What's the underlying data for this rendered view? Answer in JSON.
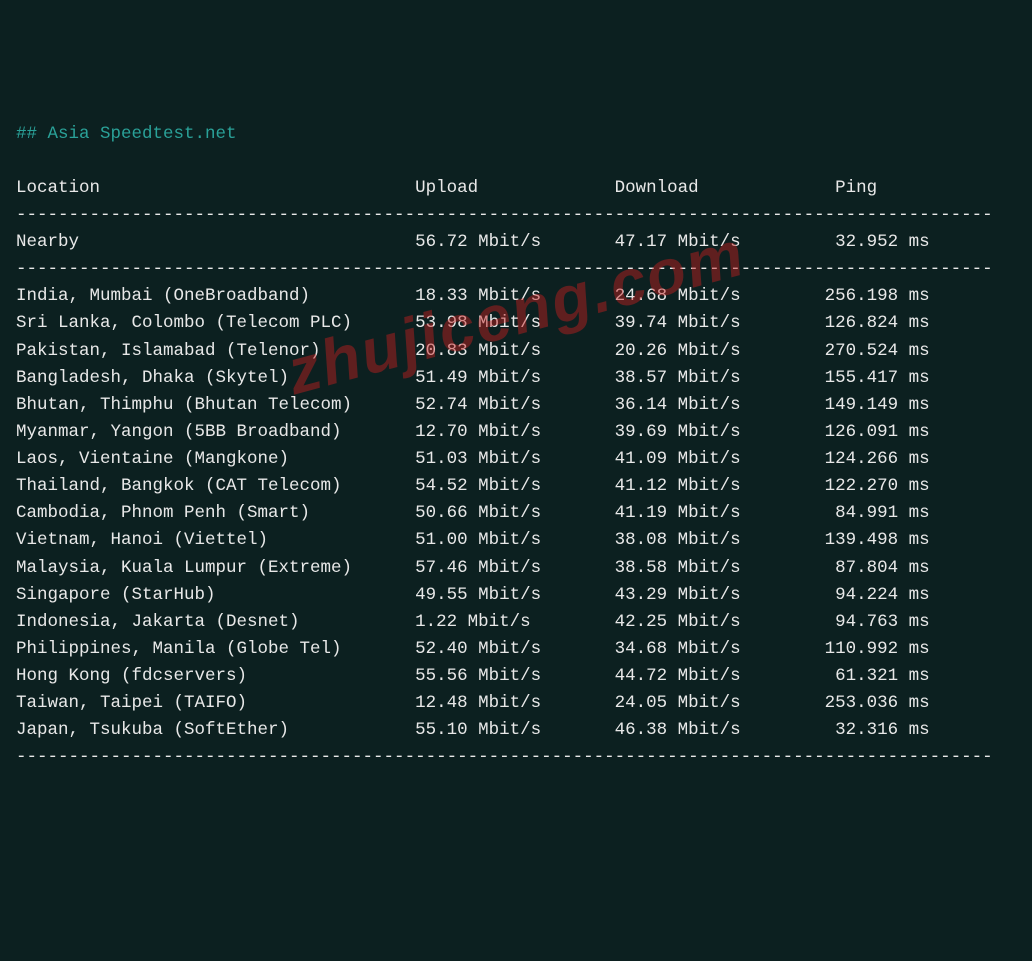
{
  "title": "## Asia Speedtest.net",
  "headers": {
    "location": "Location",
    "upload": "Upload",
    "download": "Download",
    "ping": "Ping"
  },
  "nearby": {
    "label": "Nearby",
    "upload": "56.72 Mbit/s",
    "download": "47.17 Mbit/s",
    "ping": "32.952 ms"
  },
  "rows": [
    {
      "location": "India, Mumbai (OneBroadband)",
      "upload": "18.33 Mbit/s",
      "download": "24.68 Mbit/s",
      "ping": "256.198 ms"
    },
    {
      "location": "Sri Lanka, Colombo (Telecom PLC)",
      "upload": "53.98 Mbit/s",
      "download": "39.74 Mbit/s",
      "ping": "126.824 ms"
    },
    {
      "location": "Pakistan, Islamabad (Telenor)",
      "upload": "20.83 Mbit/s",
      "download": "20.26 Mbit/s",
      "ping": "270.524 ms"
    },
    {
      "location": "Bangladesh, Dhaka (Skytel)",
      "upload": "51.49 Mbit/s",
      "download": "38.57 Mbit/s",
      "ping": "155.417 ms"
    },
    {
      "location": "Bhutan, Thimphu (Bhutan Telecom)",
      "upload": "52.74 Mbit/s",
      "download": "36.14 Mbit/s",
      "ping": "149.149 ms"
    },
    {
      "location": "Myanmar, Yangon (5BB Broadband)",
      "upload": "12.70 Mbit/s",
      "download": "39.69 Mbit/s",
      "ping": "126.091 ms"
    },
    {
      "location": "Laos, Vientaine (Mangkone)",
      "upload": "51.03 Mbit/s",
      "download": "41.09 Mbit/s",
      "ping": "124.266 ms"
    },
    {
      "location": "Thailand, Bangkok (CAT Telecom)",
      "upload": "54.52 Mbit/s",
      "download": "41.12 Mbit/s",
      "ping": "122.270 ms"
    },
    {
      "location": "Cambodia, Phnom Penh (Smart)",
      "upload": "50.66 Mbit/s",
      "download": "41.19 Mbit/s",
      "ping": "84.991 ms"
    },
    {
      "location": "Vietnam, Hanoi (Viettel)",
      "upload": "51.00 Mbit/s",
      "download": "38.08 Mbit/s",
      "ping": "139.498 ms"
    },
    {
      "location": "Malaysia, Kuala Lumpur (Extreme)",
      "upload": "57.46 Mbit/s",
      "download": "38.58 Mbit/s",
      "ping": "87.804 ms"
    },
    {
      "location": "Singapore (StarHub)",
      "upload": "49.55 Mbit/s",
      "download": "43.29 Mbit/s",
      "ping": "94.224 ms"
    },
    {
      "location": "Indonesia, Jakarta (Desnet)",
      "upload": "1.22 Mbit/s",
      "download": "42.25 Mbit/s",
      "ping": "94.763 ms"
    },
    {
      "location": "Philippines, Manila (Globe Tel)",
      "upload": "52.40 Mbit/s",
      "download": "34.68 Mbit/s",
      "ping": "110.992 ms"
    },
    {
      "location": "Hong Kong (fdcservers)",
      "upload": "55.56 Mbit/s",
      "download": "44.72 Mbit/s",
      "ping": "61.321 ms"
    },
    {
      "location": "Taiwan, Taipei (TAIFO)",
      "upload": "12.48 Mbit/s",
      "download": "24.05 Mbit/s",
      "ping": "253.036 ms"
    },
    {
      "location": "Japan, Tsukuba (SoftEther)",
      "upload": "55.10 Mbit/s",
      "download": "46.38 Mbit/s",
      "ping": "32.316 ms"
    }
  ],
  "watermark": "zhujiceng.com",
  "divider": "---------------------------------------------------------------------------------------------"
}
